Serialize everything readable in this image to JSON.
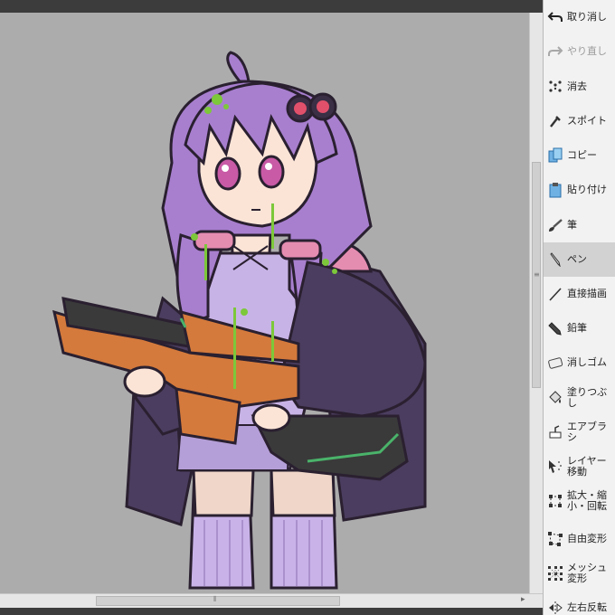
{
  "toolbar": {
    "tools": [
      {
        "label": "取り消し",
        "icon": "undo-icon",
        "enabled": true,
        "active": false
      },
      {
        "label": "やり直し",
        "icon": "redo-icon",
        "enabled": false,
        "active": false
      },
      {
        "label": "消去",
        "icon": "clear-icon",
        "enabled": true,
        "active": false
      },
      {
        "label": "スポイト",
        "icon": "eyedropper-icon",
        "enabled": true,
        "active": false
      },
      {
        "label": "コピー",
        "icon": "copy-icon",
        "enabled": true,
        "active": false
      },
      {
        "label": "貼り付け",
        "icon": "paste-icon",
        "enabled": true,
        "active": false
      },
      {
        "label": "筆",
        "icon": "brush-icon",
        "enabled": true,
        "active": false
      },
      {
        "label": "ペン",
        "icon": "pen-icon",
        "enabled": true,
        "active": true
      },
      {
        "label": "直接描画",
        "icon": "direct-draw-icon",
        "enabled": true,
        "active": false
      },
      {
        "label": "鉛筆",
        "icon": "pencil-icon",
        "enabled": true,
        "active": false
      },
      {
        "label": "消しゴム",
        "icon": "eraser-icon",
        "enabled": true,
        "active": false
      },
      {
        "label": "塗りつぶし",
        "icon": "fill-bucket-icon",
        "enabled": true,
        "active": false
      },
      {
        "label": "エアブラシ",
        "icon": "airbrush-icon",
        "enabled": true,
        "active": false
      },
      {
        "label": "レイヤー移動",
        "icon": "move-layer-icon",
        "enabled": true,
        "active": false
      },
      {
        "label": "拡大・縮小・回転",
        "icon": "scale-rotate-icon",
        "enabled": true,
        "active": false
      },
      {
        "label": "自由変形",
        "icon": "free-transform-icon",
        "enabled": true,
        "active": false
      },
      {
        "label": "メッシュ変形",
        "icon": "mesh-transform-icon",
        "enabled": true,
        "active": false
      },
      {
        "label": "左右反転",
        "icon": "flip-horizontal-icon",
        "enabled": true,
        "active": false
      }
    ]
  },
  "canvas": {
    "background": "#acacac",
    "subject": "anime girl with purple hair holding an orange blaster",
    "colors": {
      "hair": "#a87fcf",
      "jacket": "#4a3d5f",
      "dress": "#c8b3e6",
      "gun_orange": "#d47a3c",
      "slime": "#7cc83a"
    }
  },
  "colors": {
    "panel_bg": "#f2f2f2",
    "active_tool_bg": "#d2d2d2",
    "app_dark": "#3c3c3c"
  }
}
